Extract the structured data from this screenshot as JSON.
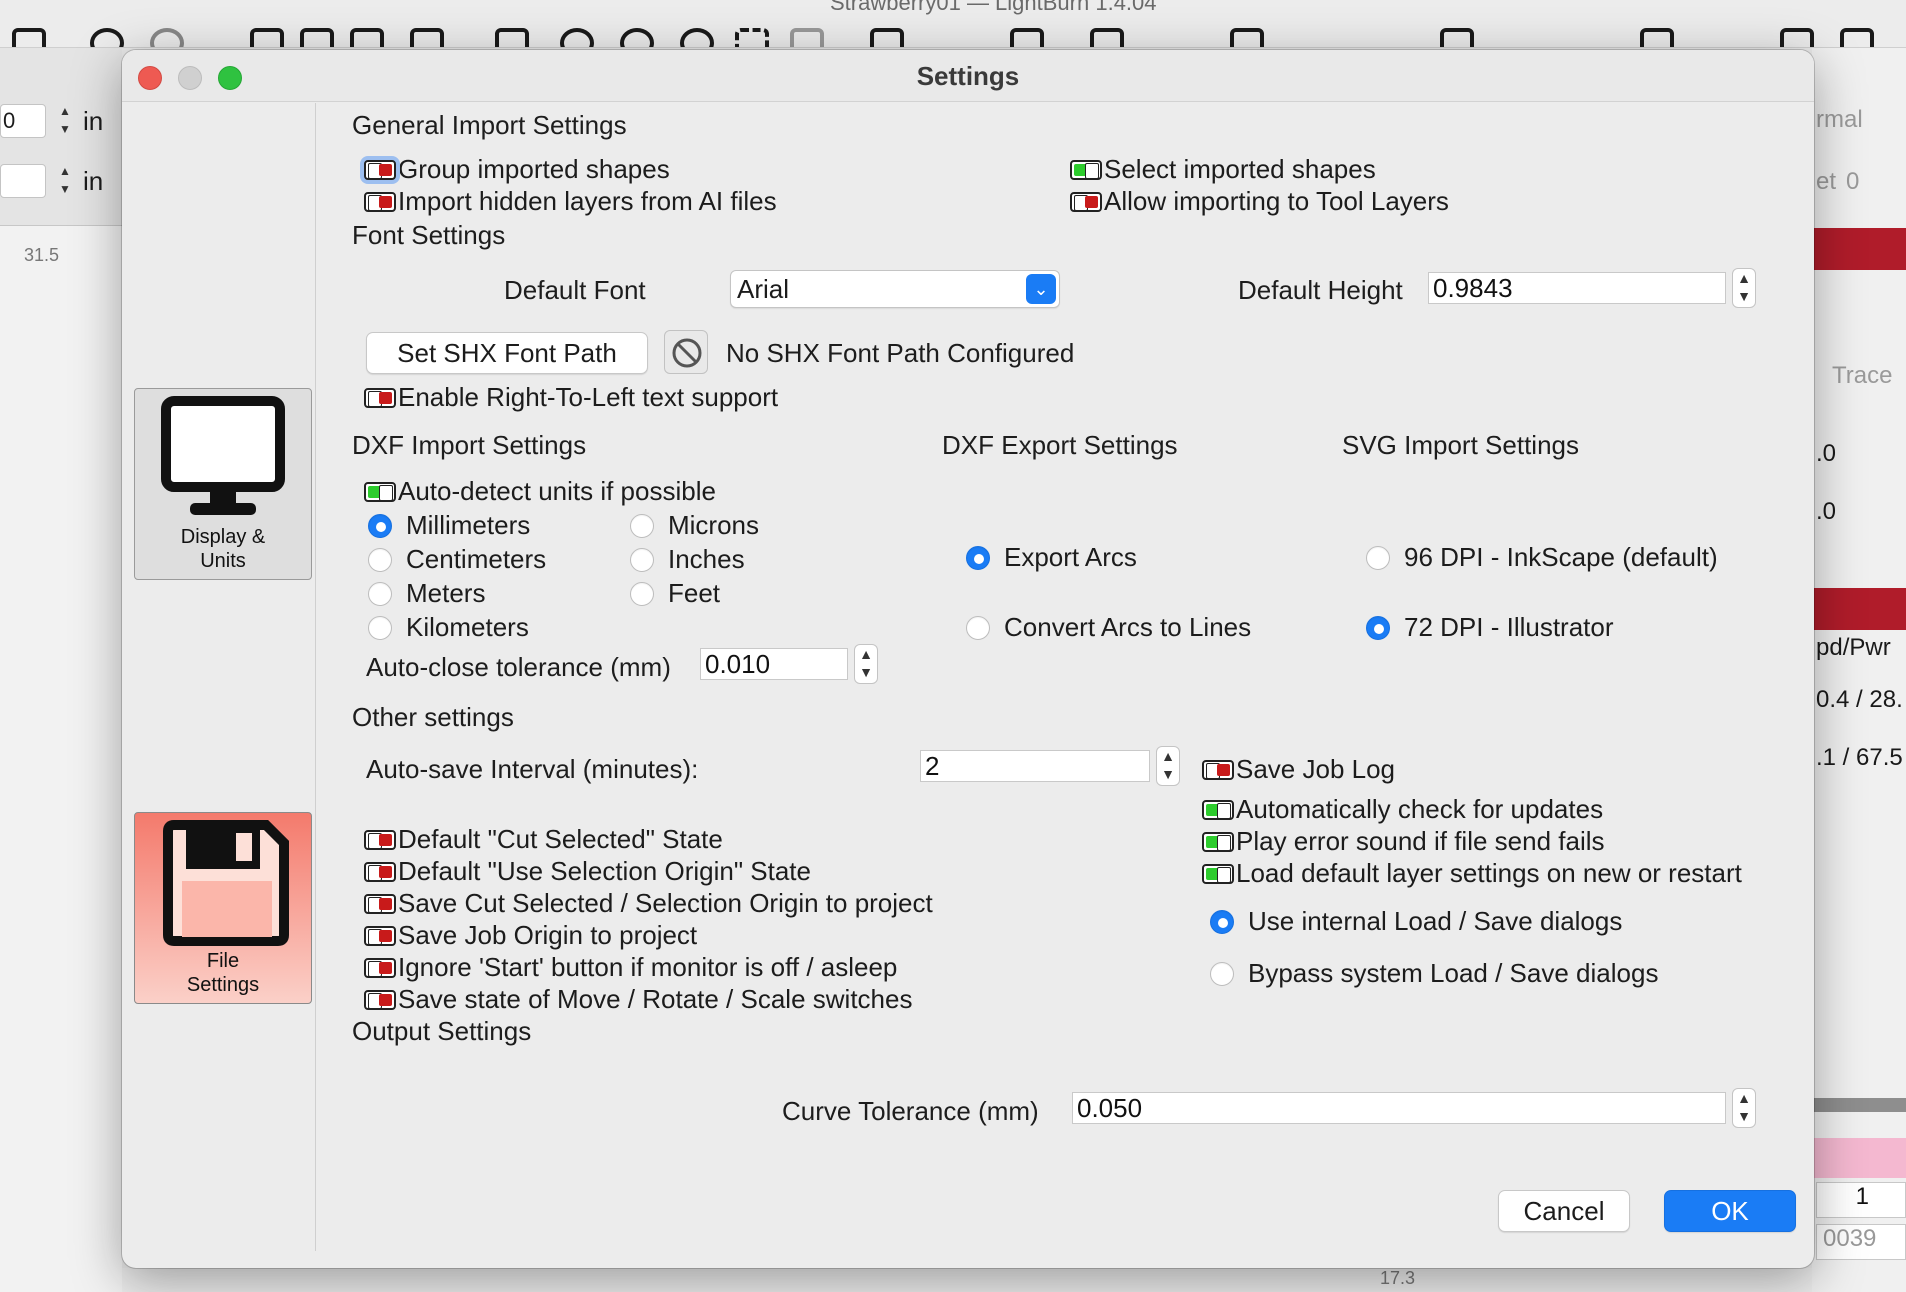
{
  "background": {
    "app_title": "Strawberry01  —  LightBurn 1.4.04",
    "left_unit_1": "in",
    "left_unit_2": "in",
    "left_value_1": "0",
    "ruler_value": "31.5",
    "right_texts": [
      "rmal",
      "et",
      "0",
      "Trace",
      ".0",
      ".0",
      "pd/Pwr",
      "0.4 / 28.",
      ".1 / 67.5",
      "1",
      "0039"
    ],
    "bottom_value": "17.3"
  },
  "dialog": {
    "title": "Settings",
    "sidebar": {
      "display_units": "Display &\nUnits",
      "file_settings": "File\nSettings"
    },
    "general_import": {
      "heading": "General Import Settings",
      "group_imported": {
        "label": "Group imported shapes",
        "on": false
      },
      "select_imported": {
        "label": "Select imported shapes",
        "on": true
      },
      "import_hidden": {
        "label": "Import hidden layers from AI files",
        "on": false
      },
      "allow_tool_layers": {
        "label": "Allow importing to Tool Layers",
        "on": false
      }
    },
    "font": {
      "heading": "Font Settings",
      "default_font_label": "Default Font",
      "default_font_value": "Arial",
      "default_height_label": "Default Height",
      "default_height_value": "0.9843",
      "set_shx_button": "Set SHX Font Path",
      "shx_status": "No SHX Font Path Configured",
      "rtl": {
        "label": "Enable Right-To-Left text support",
        "on": false
      }
    },
    "dxf_import": {
      "heading": "DXF Import Settings",
      "auto_detect": {
        "label": "Auto-detect units if possible",
        "on": true
      },
      "units": [
        "Millimeters",
        "Microns",
        "Centimeters",
        "Inches",
        "Meters",
        "Feet",
        "Kilometers"
      ],
      "selected_unit": "Millimeters",
      "auto_close_label": "Auto-close tolerance (mm)",
      "auto_close_value": "0.010"
    },
    "dxf_export": {
      "heading": "DXF Export Settings",
      "options": [
        "Export Arcs",
        "Convert Arcs to Lines"
      ],
      "selected": "Export Arcs"
    },
    "svg_import": {
      "heading": "SVG Import Settings",
      "options": [
        "96 DPI - InkScape (default)",
        "72 DPI - Illustrator"
      ],
      "selected": "72 DPI - Illustrator"
    },
    "other": {
      "heading": "Other settings",
      "autosave_label": "Auto-save Interval (minutes):",
      "autosave_value": "2",
      "toggles_left": [
        {
          "label": "Default \"Cut Selected\" State",
          "on": false
        },
        {
          "label": "Default \"Use Selection Origin\" State",
          "on": false
        },
        {
          "label": "Save Cut Selected / Selection Origin to project",
          "on": false
        },
        {
          "label": "Save Job Origin to project",
          "on": false
        },
        {
          "label": "Ignore 'Start' button if monitor is off / asleep",
          "on": false
        },
        {
          "label": "Save state of Move / Rotate / Scale switches",
          "on": false
        }
      ],
      "toggles_right": [
        {
          "label": "Save Job Log",
          "on": false
        },
        {
          "label": "Automatically check for updates",
          "on": true
        },
        {
          "label": "Play error sound if file send fails",
          "on": true
        },
        {
          "label": "Load default layer settings on new or restart",
          "on": true
        }
      ],
      "dialog_options": [
        "Use internal Load / Save dialogs",
        "Bypass system Load / Save dialogs"
      ],
      "dialog_selected": "Use internal Load / Save dialogs"
    },
    "output": {
      "heading": "Output Settings",
      "curve_tolerance_label": "Curve Tolerance (mm)",
      "curve_tolerance_value": "0.050"
    },
    "buttons": {
      "cancel": "Cancel",
      "ok": "OK"
    }
  },
  "colors": {
    "accent": "#1a7cf5",
    "toggle_on": "#2dcc2d",
    "toggle_off": "#c81a1a",
    "active_tab": "#f47a6c"
  }
}
